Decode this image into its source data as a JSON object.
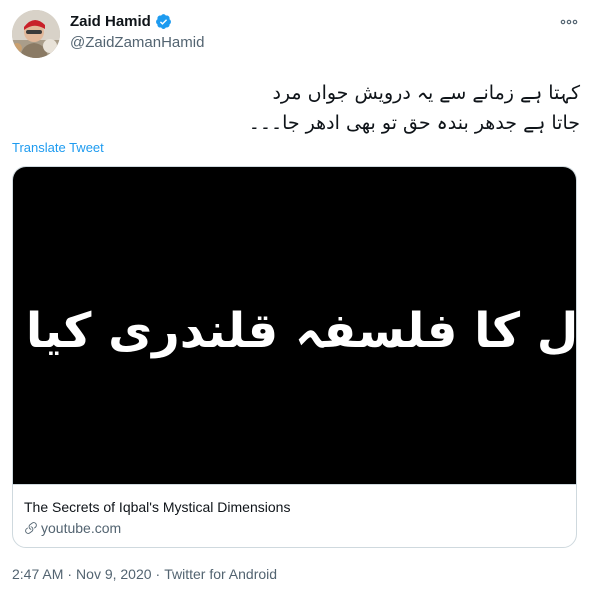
{
  "author": {
    "display_name": "Zaid Hamid",
    "handle": "@ZaidZamanHamid",
    "verified_icon": "verified-badge-icon",
    "avatar_icon": "profile-photo"
  },
  "menu": {
    "more_icon": "more-horizontal-icon"
  },
  "tweet": {
    "text_line_1": "کہتا ہے زمانے سے یہ درویش جواں مرد",
    "text_line_2": "جاتا ہے جدھر بندہ حق تو بھی ادھر جا۔۔۔",
    "translate_label": "Translate Tweet"
  },
  "card": {
    "image_text": "اقبال کا فلسفہ قلندری کیا ہے؟",
    "title": "The Secrets of Iqbal's Mystical Dimensions",
    "domain": "youtube.com",
    "link_icon": "link-icon"
  },
  "meta": {
    "time": "2:47 AM",
    "date": "Nov 9, 2020",
    "separator": "·",
    "source": "Twitter for Android"
  },
  "colors": {
    "accent": "#1d9bf0",
    "secondary_text": "#536471",
    "border": "#cfd9de"
  }
}
